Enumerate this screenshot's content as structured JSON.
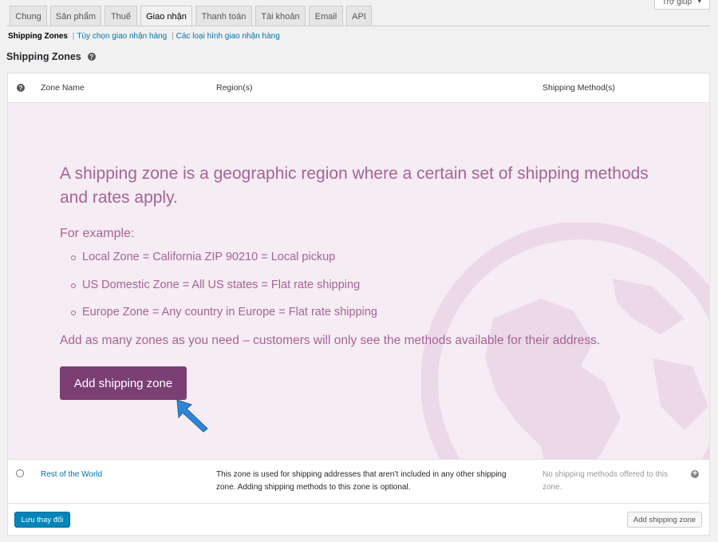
{
  "tabs": [
    {
      "label": "Chung"
    },
    {
      "label": "Sản phẩm"
    },
    {
      "label": "Thuế"
    },
    {
      "label": "Giao nhận"
    },
    {
      "label": "Thanh toán"
    },
    {
      "label": "Tài khoản"
    },
    {
      "label": "Email"
    },
    {
      "label": "API"
    }
  ],
  "active_tab": "Giao nhận",
  "help_button": {
    "label": "Trợ giúp",
    "icon": "caret-down-icon"
  },
  "subnav": {
    "current": "Shipping Zones",
    "links": [
      "Tùy chọn giao nhận hàng",
      "Các loại hình giao nhận hàng"
    ],
    "separator": "|"
  },
  "page_title": "Shipping Zones",
  "table": {
    "headers": {
      "icon": "?",
      "zone_name": "Zone Name",
      "regions": "Region(s)",
      "methods": "Shipping Method(s)"
    }
  },
  "blank_state": {
    "lead": "A shipping zone is a geographic region where a certain set of shipping methods and rates apply.",
    "example_label": "For example:",
    "examples": [
      "Local Zone = California ZIP 90210 = Local pickup",
      "US Domestic Zone = All US states = Flat rate shipping",
      "Europe Zone = Any country in Europe = Flat rate shipping"
    ],
    "note": "Add as many zones as you need – customers will only see the methods available for their address.",
    "button_label": "Add shipping zone"
  },
  "rest_of_world": {
    "name": "Rest of the World",
    "region_text": "This zone is used for shipping addresses that aren’t included in any other shipping zone. Adding shipping methods to this zone is optional.",
    "methods_text": "No shipping methods offered to this zone."
  },
  "footer": {
    "save_label": "Lưu thay đổi",
    "add_zone_label": "Add shipping zone"
  },
  "colors": {
    "accent": "#a46497",
    "primary_button": "#7b3f74",
    "blank_bg": "#f6ecf3",
    "save_button": "#0085ba"
  }
}
